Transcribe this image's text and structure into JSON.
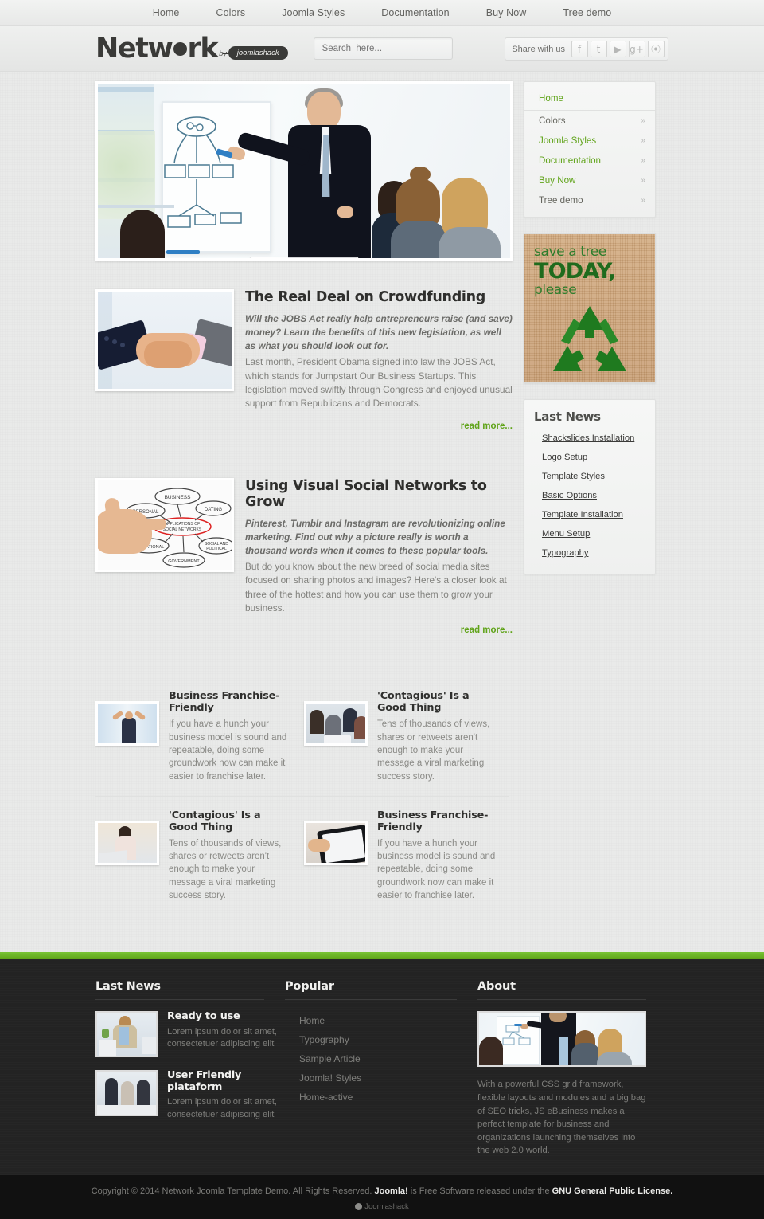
{
  "topnav": {
    "items": [
      {
        "label": "Home"
      },
      {
        "label": "Colors"
      },
      {
        "label": "Joomla Styles"
      },
      {
        "label": "Documentation"
      },
      {
        "label": "Buy Now"
      },
      {
        "label": "Tree demo"
      }
    ]
  },
  "header": {
    "logo_part1": "Netw",
    "logo_part2": "rk",
    "logo_by": "by",
    "logo_badge": "joomlashack",
    "search_placeholder": "Search  here...",
    "share_label": "Share with us",
    "social": [
      {
        "name": "facebook-icon",
        "glyph": "f"
      },
      {
        "name": "twitter-icon",
        "glyph": "t"
      },
      {
        "name": "youtube-icon",
        "glyph": "▶"
      },
      {
        "name": "googleplus-icon",
        "glyph": "g+"
      },
      {
        "name": "rss-icon",
        "glyph": "⦿"
      }
    ]
  },
  "slider": {
    "nav_prev": "◀",
    "nav_next": "▶",
    "dots": 5,
    "active_dot": 4
  },
  "articles": [
    {
      "title": "The Real Deal on Crowdfunding",
      "lead": "Will the JOBS Act really help entrepreneurs raise (and save) money? Learn the benefits of this new legislation, as well as what you should look out for.",
      "text": "Last month, President Obama signed into law the JOBS Act, which stands for Jumpstart Our Business Startups. This legislation moved swiftly through Congress and enjoyed unusual support from Republicans and Democrats.",
      "readmore": "read more...",
      "image": "handshake-photo"
    },
    {
      "title": "Using Visual Social Networks to Grow",
      "lead": "Pinterest, Tumblr and Instagram are revolutionizing online marketing. Find out why a picture really is worth a thousand words when it comes to these popular tools.",
      "text": "But do you know about the new breed of social media sites focused on sharing photos and images? Here's a closer look at three of the hottest and how you can use them to grow your business.",
      "readmore": "read more...",
      "image": "social-network-diagram-photo"
    }
  ],
  "grid": [
    {
      "title": "Business Franchise-Friendly",
      "text": "If you have a hunch your business model is sound and repeatable, doing some groundwork now can make it easier to franchise later.",
      "image": "cheering-businessman-photo"
    },
    {
      "title": "'Contagious' Is a Good Thing",
      "text": "Tens of thousands of views, shares or retweets aren't enough to make your message a viral marketing success story.",
      "image": "team-meeting-photo"
    },
    {
      "title": "'Contagious' Is a Good Thing",
      "text": "Tens of thousands of views, shares or retweets aren't enough to make your message a viral marketing success story.",
      "image": "woman-laptop-photo"
    },
    {
      "title": "Business Franchise-Friendly",
      "text": "If you have a hunch your business model is sound and repeatable, doing some groundwork now can make it easier to franchise later.",
      "image": "tablet-hand-photo"
    }
  ],
  "sidebar": {
    "menu": [
      {
        "label": "Home",
        "arrow": ""
      },
      {
        "label": "Colors",
        "arrow": "»"
      },
      {
        "label": "Joomla Styles",
        "arrow": "»"
      },
      {
        "label": "Documentation",
        "arrow": "»"
      },
      {
        "label": "Buy Now",
        "arrow": "»"
      },
      {
        "label": "Tree demo",
        "arrow": "»"
      }
    ],
    "banner": {
      "line1": "save a tree",
      "line2": "TODAY,",
      "line3": "please"
    },
    "lastnews": {
      "heading": "Last News",
      "items": [
        {
          "label": "Shackslides Installation"
        },
        {
          "label": "Logo Setup"
        },
        {
          "label": "Template Styles"
        },
        {
          "label": "Basic Options"
        },
        {
          "label": "Template Installation"
        },
        {
          "label": "Menu Setup"
        },
        {
          "label": "Typography"
        }
      ]
    }
  },
  "footer": {
    "lastnews": {
      "heading": "Last News",
      "items": [
        {
          "title": "Ready to use",
          "text": "Lorem ipsum dolor sit amet, consectetuer adipiscing elit",
          "image": "man-at-desk-photo"
        },
        {
          "title": "User Friendly plataform",
          "text": "Lorem ipsum dolor sit amet, consectetuer adipiscing elit",
          "image": "team-standing-photo"
        }
      ]
    },
    "popular": {
      "heading": "Popular",
      "items": [
        {
          "label": "Home"
        },
        {
          "label": "Typography"
        },
        {
          "label": "Sample Article"
        },
        {
          "label": "Joomla! Styles"
        },
        {
          "label": "Home-active"
        }
      ]
    },
    "about": {
      "heading": "About",
      "image": "presentation-photo",
      "text": "With a powerful CSS grid framework, flexible layouts and modules and a big bag of SEO tricks, JS eBusiness makes a perfect template for business and organizations launching themselves into the web 2.0 world."
    }
  },
  "copyright": {
    "part1": "Copyright © 2014 Network Joomla Template Demo. All Rights Reserved. ",
    "joomla": "Joomla!",
    "part2": " is Free Software released under the ",
    "license": "GNU General Public License.",
    "badge": "Joomlashack"
  },
  "colors": {
    "accent_green": "#5fa318",
    "bar_green": "#79c436",
    "footer_bg": "#232323",
    "copyright_bg": "#111111",
    "page_bg": "#e9eae9",
    "banner_tan": "#cfa87e",
    "banner_green": "#1f6b1d"
  }
}
